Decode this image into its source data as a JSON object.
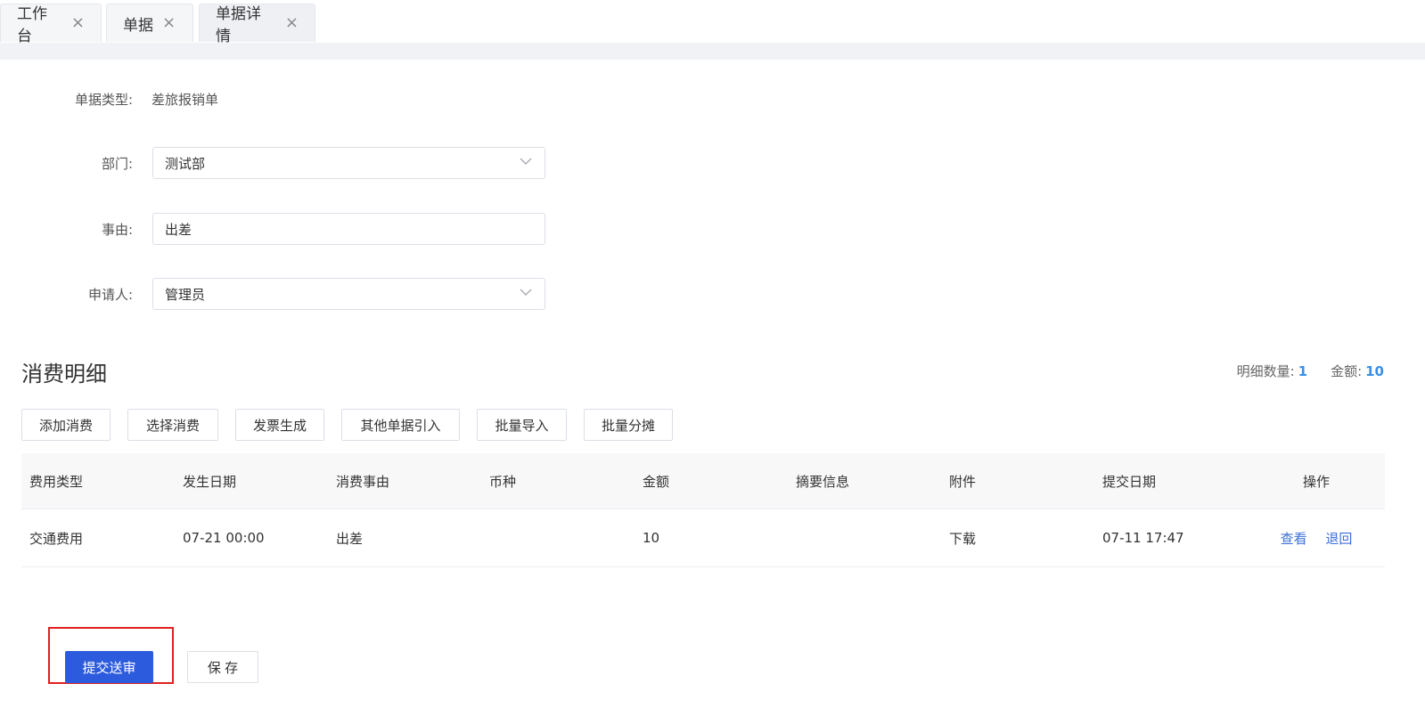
{
  "tabs": [
    {
      "label": "工作台",
      "close": "×"
    },
    {
      "label": "单据",
      "close": "×"
    },
    {
      "label": "单据详情",
      "close": "×"
    }
  ],
  "form": {
    "doc_type_label": "单据类型:",
    "doc_type_value": "差旅报销单",
    "department_label": "部门:",
    "department_value": "测试部",
    "reason_label": "事由:",
    "reason_value": "出差",
    "applicant_label": "申请人:",
    "applicant_value": "管理员"
  },
  "section": {
    "title": "消费明细",
    "detail_count_label": "明细数量:",
    "detail_count": "1",
    "amount_label": "金额:",
    "amount": "10"
  },
  "toolbar": {
    "add_expense": "添加消费",
    "select_expense": "选择消费",
    "invoice_generate": "发票生成",
    "import_other": "其他单据引入",
    "batch_import": "批量导入",
    "batch_allocate": "批量分摊"
  },
  "table": {
    "headers": [
      "费用类型",
      "发生日期",
      "消费事由",
      "币种",
      "金额",
      "摘要信息",
      "附件",
      "提交日期",
      "操作"
    ],
    "rows": [
      {
        "type": "交通费用",
        "date": "07-21 00:00",
        "reason": "出差",
        "currency": "",
        "amount": "10",
        "summary": "",
        "attachment": "下载",
        "submit_date": "07-11 17:47",
        "view": "查看",
        "return": "退回"
      }
    ]
  },
  "footer": {
    "submit_label": "提交送审",
    "save_label": "保 存"
  },
  "colors": {
    "primary_button": "#2c5cdd",
    "link": "#3a6fd8",
    "summary_number": "#3a8ee6",
    "highlight_border": "#e02020"
  }
}
